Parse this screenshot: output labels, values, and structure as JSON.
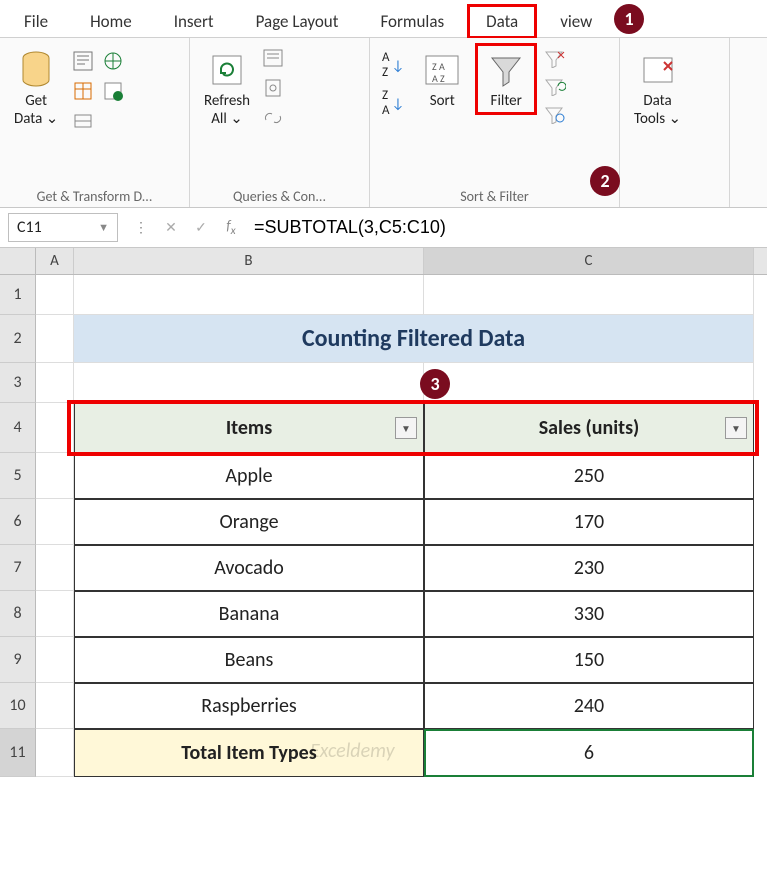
{
  "tabs": {
    "file": "File",
    "home": "Home",
    "insert": "Insert",
    "page_layout": "Page Layout",
    "formulas": "Formulas",
    "data": "Data",
    "view": "view"
  },
  "ribbon": {
    "get_data": "Get\nData ⌄",
    "group1_label": "Get & Transform D...",
    "refresh_all": "Refresh\nAll ⌄",
    "group2_label": "Queries & Con...",
    "sort": "Sort",
    "filter": "Filter",
    "group3_label": "Sort & Filter",
    "data_tools": "Data\nTools ⌄"
  },
  "name_box": "C11",
  "formula": "=SUBTOTAL(3,C5:C10)",
  "columns": {
    "A": "A",
    "B": "B",
    "C": "C"
  },
  "title": "Counting Filtered Data",
  "headers": {
    "items": "Items",
    "sales": "Sales (units)"
  },
  "rows": [
    {
      "item": "Apple",
      "sales": "250"
    },
    {
      "item": "Orange",
      "sales": "170"
    },
    {
      "item": "Avocado",
      "sales": "230"
    },
    {
      "item": "Banana",
      "sales": "330"
    },
    {
      "item": "Beans",
      "sales": "150"
    },
    {
      "item": "Raspberries",
      "sales": "240"
    }
  ],
  "total_label": "Total Item Types",
  "total_value": "6",
  "callouts": {
    "c1": "1",
    "c2": "2",
    "c3": "3"
  },
  "watermark": "Exceldemy",
  "rownums": [
    "1",
    "2",
    "3",
    "4",
    "5",
    "6",
    "7",
    "8",
    "9",
    "10",
    "11"
  ]
}
